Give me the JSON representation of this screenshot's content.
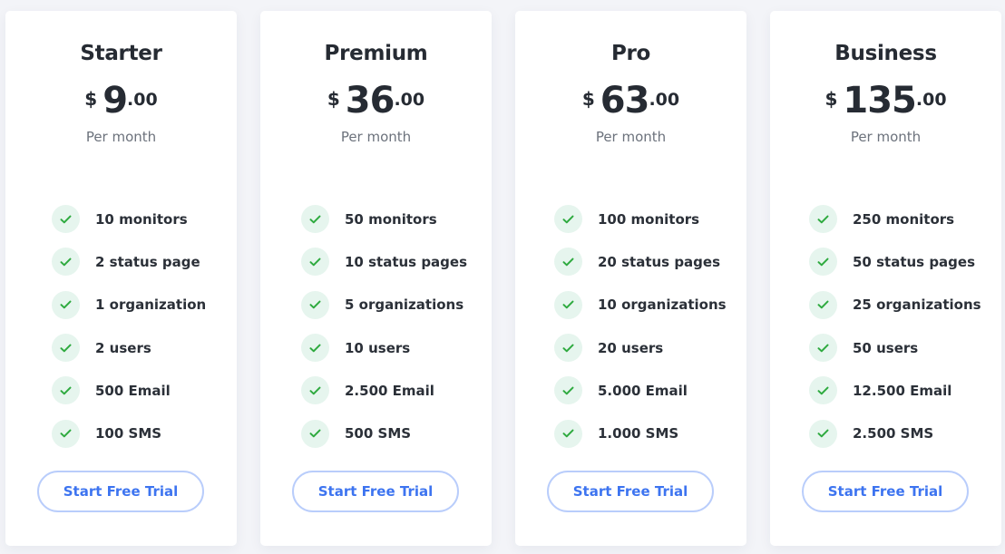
{
  "currency_symbol": "$",
  "colors": {
    "accent": "#3d74f0",
    "check": "#2eaa3f",
    "check_bg": "#e6f5ee",
    "button_border": "#b9cdfb"
  },
  "plans": [
    {
      "name": "Starter",
      "price_whole": "9",
      "price_decimal": ".00",
      "period": "Per month",
      "features": [
        "10 monitors",
        "2 status page",
        "1 organization",
        "2 users",
        "500 Email",
        "100 SMS"
      ],
      "cta": "Start Free Trial"
    },
    {
      "name": "Premium",
      "price_whole": "36",
      "price_decimal": ".00",
      "period": "Per month",
      "features": [
        "50 monitors",
        "10 status pages",
        "5 organizations",
        "10 users",
        "2.500 Email",
        "500 SMS"
      ],
      "cta": "Start Free Trial"
    },
    {
      "name": "Pro",
      "price_whole": "63",
      "price_decimal": ".00",
      "period": "Per month",
      "features": [
        "100 monitors",
        "20 status pages",
        "10 organizations",
        "20 users",
        "5.000 Email",
        "1.000 SMS"
      ],
      "cta": "Start Free Trial"
    },
    {
      "name": "Business",
      "price_whole": "135",
      "price_decimal": ".00",
      "period": "Per month",
      "features": [
        "250 monitors",
        "50 status pages",
        "25 organizations",
        "50 users",
        "12.500 Email",
        "2.500 SMS"
      ],
      "cta": "Start Free Trial"
    }
  ]
}
